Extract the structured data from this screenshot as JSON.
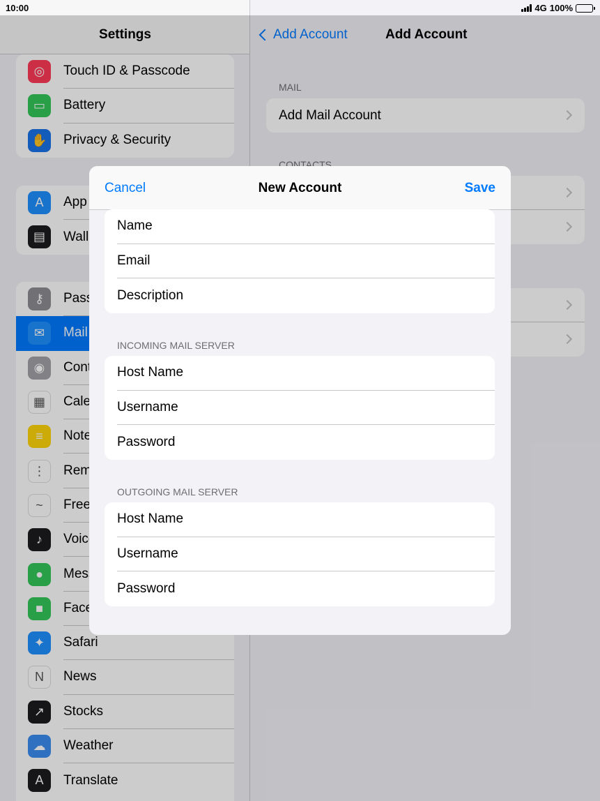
{
  "status_bar": {
    "time": "10:00",
    "network": "4G",
    "battery": "100%"
  },
  "settings": {
    "title": "Settings",
    "group1": [
      {
        "label": "Touch ID & Passcode",
        "icon": "fingerprint-icon",
        "color": "#ff3b57"
      },
      {
        "label": "Battery",
        "icon": "battery-icon",
        "color": "#34c759"
      },
      {
        "label": "Privacy & Security",
        "icon": "hand-icon",
        "color": "#1a73e8"
      }
    ],
    "group2": [
      {
        "label": "App Store",
        "icon": "app-store-icon",
        "color": "#1e90ff"
      },
      {
        "label": "Wallet & Apple Pay",
        "icon": "wallet-icon",
        "color": "#1c1c1e"
      }
    ],
    "group3": [
      {
        "label": "Passwords",
        "icon": "key-icon",
        "color": "#8e8e93"
      },
      {
        "label": "Mail",
        "icon": "envelope-icon",
        "color": "#1e90ff",
        "selected": true
      },
      {
        "label": "Contacts",
        "icon": "contacts-icon",
        "color": "#a3a3a8"
      },
      {
        "label": "Calendar",
        "icon": "calendar-icon",
        "color": "#ffffff"
      },
      {
        "label": "Notes",
        "icon": "notes-icon",
        "color": "#ffd60a"
      },
      {
        "label": "Reminders",
        "icon": "reminders-icon",
        "color": "#ffffff"
      },
      {
        "label": "Freeform",
        "icon": "freeform-icon",
        "color": "#ffffff"
      },
      {
        "label": "Voice Memos",
        "icon": "voice-memos-icon",
        "color": "#1c1c1e"
      },
      {
        "label": "Messages",
        "icon": "messages-icon",
        "color": "#34c759"
      },
      {
        "label": "FaceTime",
        "icon": "facetime-icon",
        "color": "#34c759"
      },
      {
        "label": "Safari",
        "icon": "safari-icon",
        "color": "#1e90ff"
      },
      {
        "label": "News",
        "icon": "news-icon",
        "color": "#ffffff"
      },
      {
        "label": "Stocks",
        "icon": "stocks-icon",
        "color": "#1c1c1e"
      },
      {
        "label": "Weather",
        "icon": "weather-icon",
        "color": "#3d8cf0"
      },
      {
        "label": "Translate",
        "icon": "translate-icon",
        "color": "#1c1c1e"
      }
    ]
  },
  "add_account": {
    "back_label": "Add Account",
    "title": "Add Account",
    "mail_section": "MAIL",
    "add_mail_account": "Add Mail Account",
    "contacts_section": "CONTACTS"
  },
  "modal": {
    "cancel": "Cancel",
    "title": "New Account",
    "save": "Save",
    "account_fields": [
      "Name",
      "Email",
      "Description"
    ],
    "incoming_section": "INCOMING MAIL SERVER",
    "incoming_fields": [
      "Host Name",
      "Username",
      "Password"
    ],
    "outgoing_section": "OUTGOING MAIL SERVER",
    "outgoing_fields": [
      "Host Name",
      "Username",
      "Password"
    ]
  },
  "colors": {
    "accent": "#007aff"
  }
}
